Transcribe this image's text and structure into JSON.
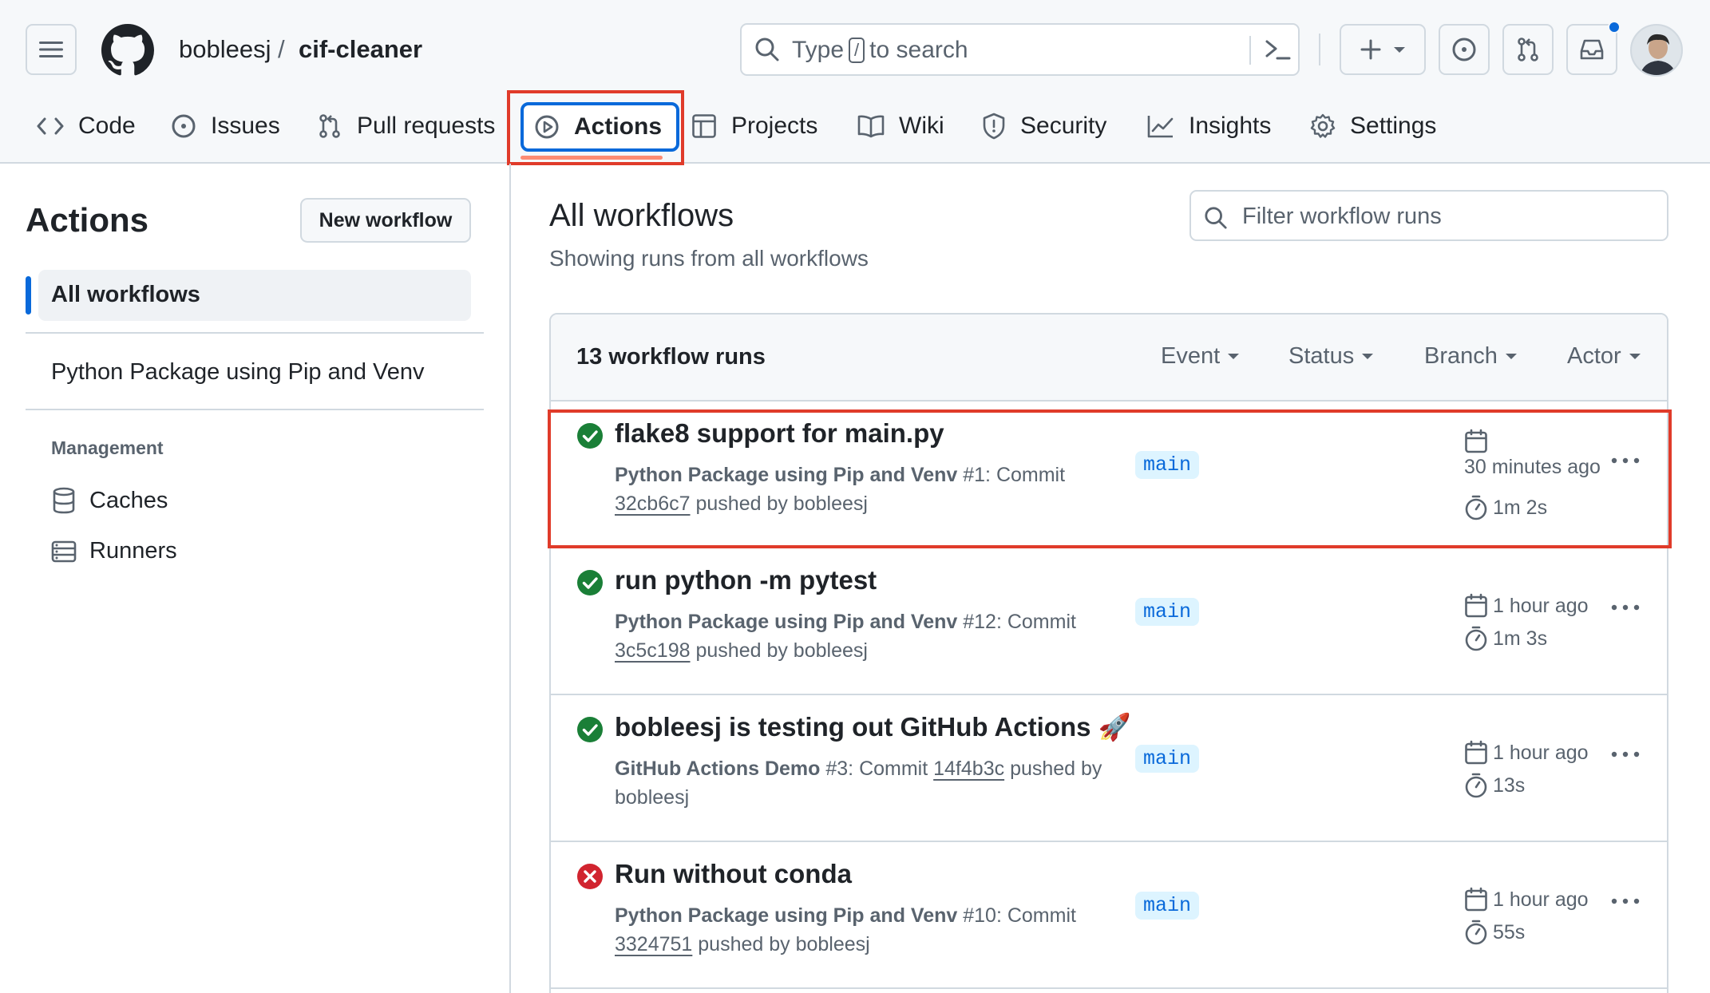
{
  "header": {
    "owner": "bobleesj",
    "separator": "/",
    "repo": "cif-cleaner",
    "search": {
      "prefix": "Type",
      "key": "/",
      "suffix": "to search"
    }
  },
  "tabs": [
    {
      "label": "Code",
      "icon": "code-icon"
    },
    {
      "label": "Issues",
      "icon": "issue-icon"
    },
    {
      "label": "Pull requests",
      "icon": "pull-request-icon"
    },
    {
      "label": "Actions",
      "icon": "play-icon",
      "active": true
    },
    {
      "label": "Projects",
      "icon": "table-icon"
    },
    {
      "label": "Wiki",
      "icon": "book-icon"
    },
    {
      "label": "Security",
      "icon": "shield-icon"
    },
    {
      "label": "Insights",
      "icon": "graph-icon"
    },
    {
      "label": "Settings",
      "icon": "gear-icon"
    }
  ],
  "sidebar": {
    "title": "Actions",
    "new_workflow": "New workflow",
    "all_workflows": "All workflows",
    "workflows": [
      "Python Package using Pip and Venv"
    ],
    "management_heading": "Management",
    "management_items": [
      {
        "label": "Caches",
        "icon": "database-icon"
      },
      {
        "label": "Runners",
        "icon": "server-icon"
      }
    ]
  },
  "main": {
    "title": "All workflows",
    "subtitle": "Showing runs from all workflows",
    "filter_placeholder": "Filter workflow runs",
    "run_count": "13 workflow runs",
    "filters": [
      "Event",
      "Status",
      "Branch",
      "Actor"
    ],
    "runs": [
      {
        "status": "success",
        "title": "flake8 support for main.py",
        "workflow": "Python Package using Pip and Venv",
        "run": "#1: Commit",
        "sha": "32cb6c7",
        "pusher": "pushed by bobleesj",
        "branch": "main",
        "time": "30 minutes ago",
        "duration": "1m 2s"
      },
      {
        "status": "success",
        "title": "run python -m pytest",
        "workflow": "Python Package using Pip and Venv",
        "run": "#12: Commit",
        "sha": "3c5c198",
        "pusher": "pushed by bobleesj",
        "branch": "main",
        "time": "1 hour ago",
        "duration": "1m 3s"
      },
      {
        "status": "success",
        "title": "bobleesj is testing out GitHub Actions 🚀",
        "workflow": "GitHub Actions Demo",
        "run": "#3: Commit",
        "sha": "14f4b3c",
        "pusher": "pushed by bobleesj",
        "branch": "main",
        "time": "1 hour ago",
        "duration": "13s"
      },
      {
        "status": "failure",
        "title": "Run without conda",
        "workflow": "Python Package using Pip and Venv",
        "run": "#10: Commit",
        "sha": "3324751",
        "pusher": "pushed by bobleesj",
        "branch": "main",
        "time": "1 hour ago",
        "duration": "55s"
      }
    ]
  },
  "colors": {
    "accent": "#0969da",
    "success": "#1a7f37",
    "failure": "#d1242f",
    "highlight": "#e03b2a"
  }
}
